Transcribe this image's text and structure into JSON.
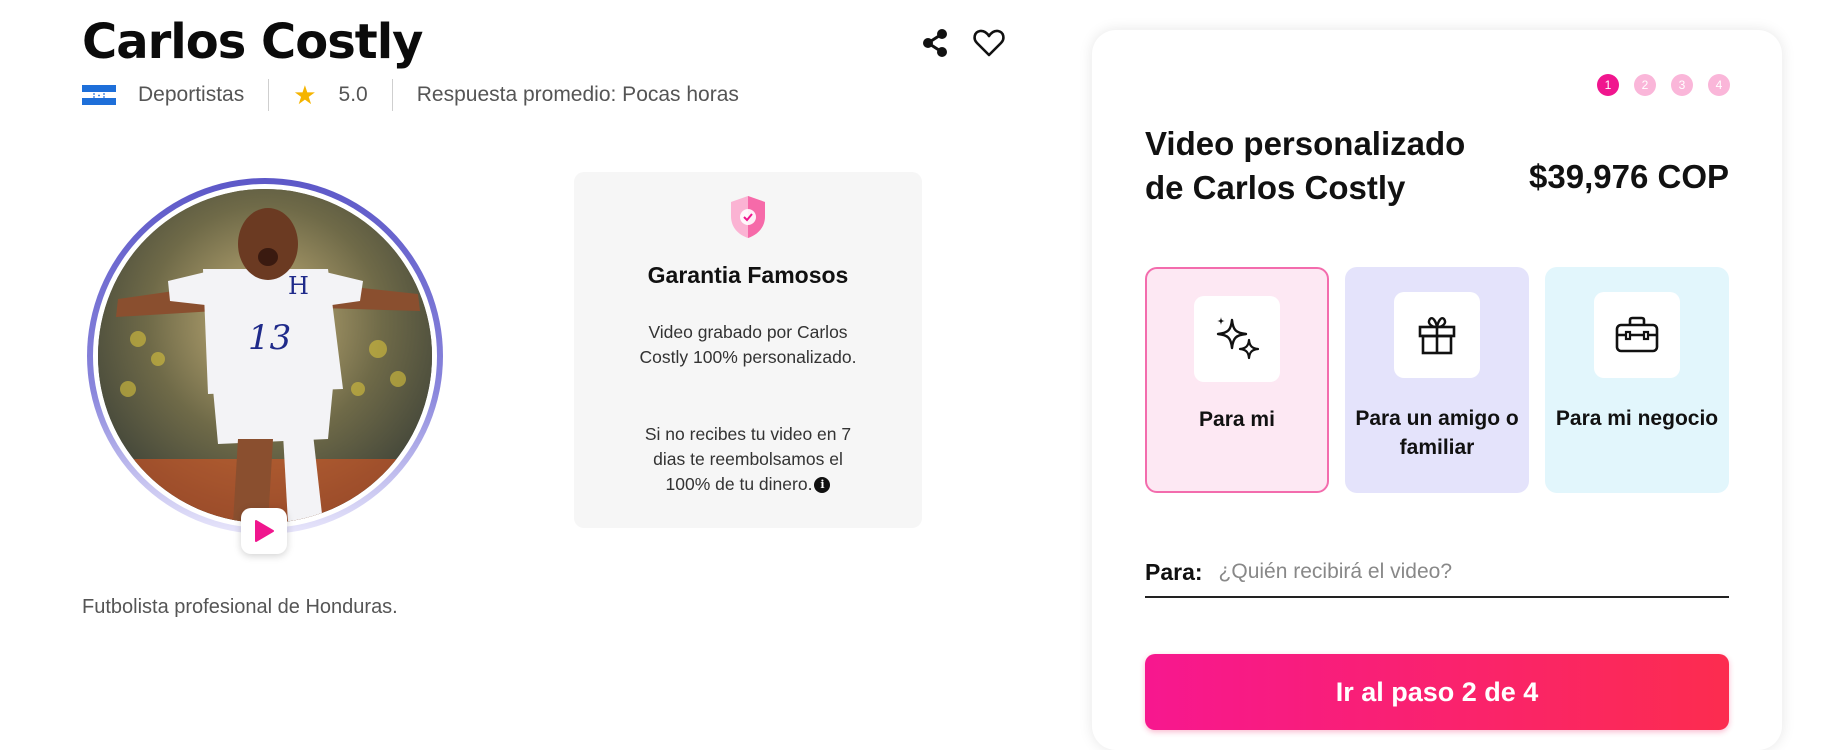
{
  "profile": {
    "name": "Carlos Costly",
    "flag_icon": "honduras-flag-icon",
    "category": "Deportistas",
    "rating": "5.0",
    "response_time": "Respuesta promedio: Pocas horas",
    "bio": "Futbolista profesional de Honduras."
  },
  "actions": {
    "share_icon": "share-icon",
    "favorite_icon": "heart-icon",
    "play_icon": "play-icon"
  },
  "guarantee": {
    "title": "Garantia Famosos",
    "text1": "Video grabado por Carlos Costly 100% personalizado.",
    "text2": "Si no recibes tu video en 7 dias te reembolsamos el 100% de tu dinero."
  },
  "order": {
    "steps": [
      "1",
      "2",
      "3",
      "4"
    ],
    "active_step": 1,
    "title": "Video personalizado de Carlos Costly",
    "price": "$39,976 COP",
    "options": [
      {
        "label": "Para mi",
        "icon": "sparkles-icon",
        "selected": true
      },
      {
        "label": "Para un amigo o familiar",
        "icon": "gift-icon",
        "selected": false
      },
      {
        "label": "Para mi negocio",
        "icon": "briefcase-icon",
        "selected": false
      }
    ],
    "recipient_label": "Para:",
    "recipient_placeholder": "¿Quién recibirá el video?",
    "recipient_value": "",
    "cta_label": "Ir al paso 2 de 4"
  },
  "colors": {
    "accent": "#f0168e",
    "accent_end": "#fc2c4f",
    "option1_bg": "#fde8f3",
    "option2_bg": "#e4e3fb",
    "option3_bg": "#e2f6fc",
    "star": "#f5b400"
  }
}
